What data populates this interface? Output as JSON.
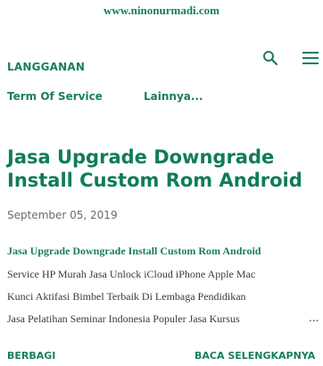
{
  "header": {
    "site_url": "www.ninonurmadi.com",
    "subscribe_label": "LANGGANAN",
    "search_icon": "search-icon",
    "menu_icon": "hamburger-menu-icon"
  },
  "nav": {
    "items": [
      {
        "label": "Term Of Service"
      },
      {
        "label": "Lainnya..."
      }
    ]
  },
  "post": {
    "title": "Jasa Upgrade Downgrade Install Custom Rom Android",
    "date": "September 05, 2019",
    "snippet_link": "Jasa Upgrade Downgrade Install Custom Rom Android",
    "snippet_lines": [
      "Service HP Murah Jasa Unlock iCloud iPhone Apple Mac",
      "Kunci Aktifasi Bimbel Terbaik Di Lembaga Pendidikan",
      "Jasa Pelatihan Seminar Indonesia Populer Jasa Kursus"
    ],
    "ellipsis": "...",
    "share_label": "BERBAGI",
    "read_more_label": "BACA SELENGKAPNYA"
  },
  "colors": {
    "accent": "#1a7f5a",
    "title": "#0f7d55",
    "text": "#3a3a3a",
    "muted": "#6b6b6b"
  }
}
